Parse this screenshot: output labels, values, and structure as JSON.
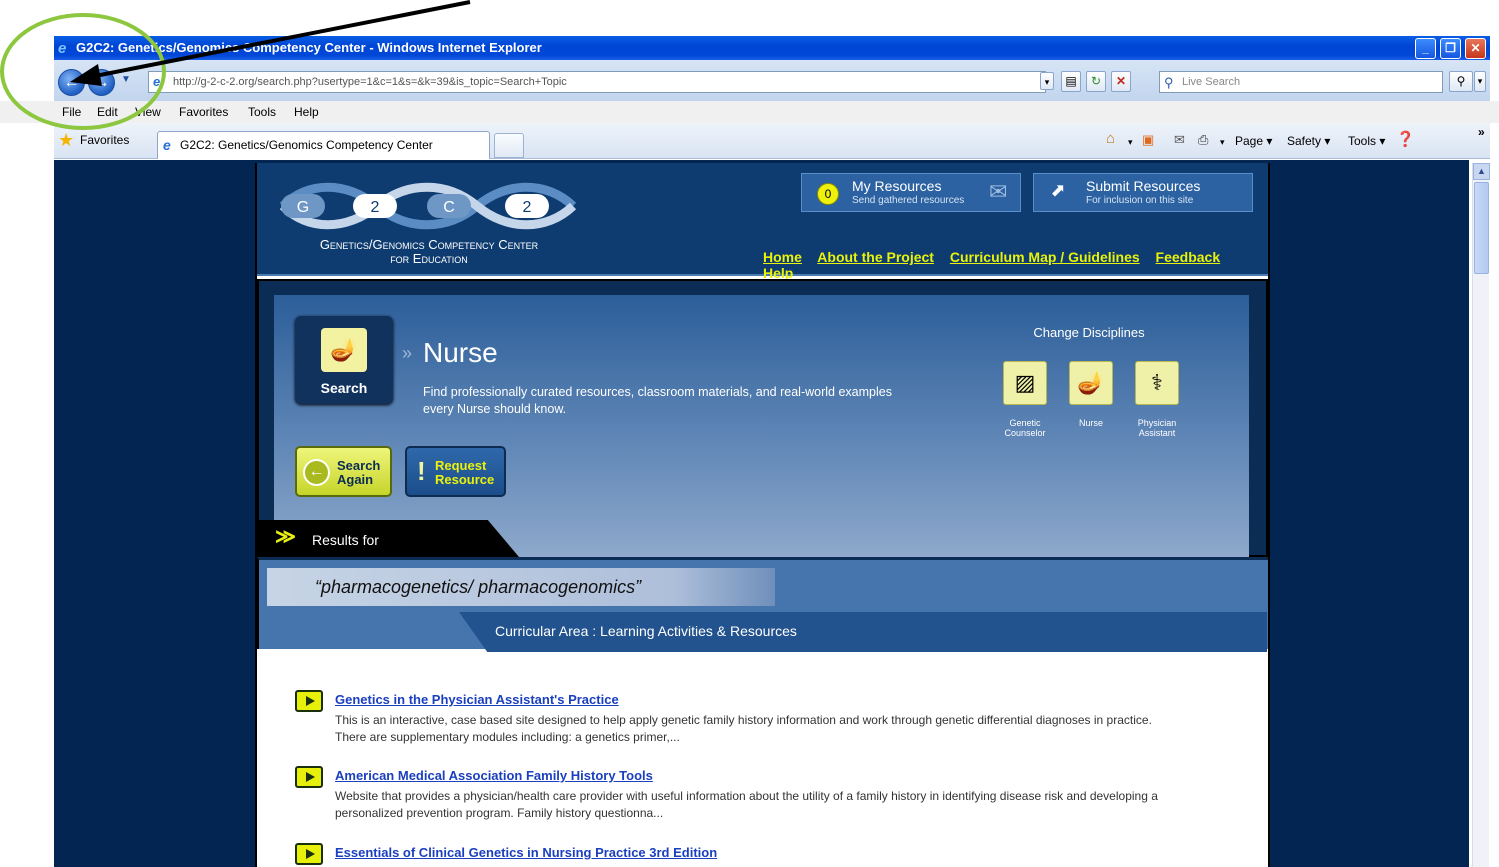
{
  "window": {
    "title": "G2C2: Genetics/Genomics Competency Center - Windows Internet Explorer",
    "minimize": "_",
    "restore": "❐",
    "close": "✕"
  },
  "address_bar": {
    "url": "http://g-2-c-2.org/search.php?usertype=1&c=1&s=&k=39&is_topic=Search+Topic",
    "search_placeholder": "Live Search"
  },
  "menu": [
    "File",
    "Edit",
    "View",
    "Favorites",
    "Tools",
    "Help"
  ],
  "favorites_bar": {
    "favorites_label": "Favorites",
    "tab_title": "G2C2: Genetics/Genomics Competency Center",
    "commands": [
      "Page ▾",
      "Safety ▾",
      "Tools ▾"
    ]
  },
  "site": {
    "logo_letters": [
      "G",
      "2",
      "C",
      "2"
    ],
    "tagline_line1": "Genetics/Genomics Competency Center",
    "tagline_line2": "for Education",
    "my_resources": {
      "count": "0",
      "title": "My Resources",
      "subtitle": "Send gathered resources"
    },
    "submit_resources": {
      "title": "Submit Resources",
      "subtitle": "For inclusion on this site"
    },
    "nav": [
      "Home",
      "About the Project",
      "Curriculum Map / Guidelines",
      "Feedback",
      "Help"
    ]
  },
  "hero": {
    "badge_label": "Search",
    "discipline": "Nurse",
    "description": "Find professionally curated resources, classroom materials, and real-world examples every Nurse should know.",
    "change_disciplines": "Change Disciplines",
    "disciplines": [
      "Genetic Counselor",
      "Nurse",
      "Physician Assistant"
    ],
    "search_again": [
      "Search",
      "Again"
    ],
    "request_resource": [
      "Request",
      "Resource"
    ],
    "results_for": "Results for"
  },
  "query": {
    "text": "“pharmacogenetics/ pharmacogenomics”",
    "curricular_area": "Curricular Area : Learning Activities & Resources"
  },
  "results": [
    {
      "title": "Genetics in the Physician Assistant's Practice",
      "description": "This is an interactive, case based site designed to help apply genetic family history information and work through genetic differential diagnoses in practice. There are supplementary modules including: a genetics primer,..."
    },
    {
      "title": "American Medical Association Family History Tools",
      "description": "Website that provides a physician/health care provider with useful information about the utility of a family history in identifying disease risk and developing a personalized prevention program. Family history questionna..."
    },
    {
      "title": "Essentials of Clinical Genetics in Nursing Practice 3rd Edition",
      "description": ""
    }
  ],
  "colors": {
    "page_bg": "#022551",
    "header_bg": "#0e3c70",
    "nav_link": "#e8f20a",
    "result_link": "#1a3fbf",
    "annotation_circle": "#8dc63f"
  }
}
